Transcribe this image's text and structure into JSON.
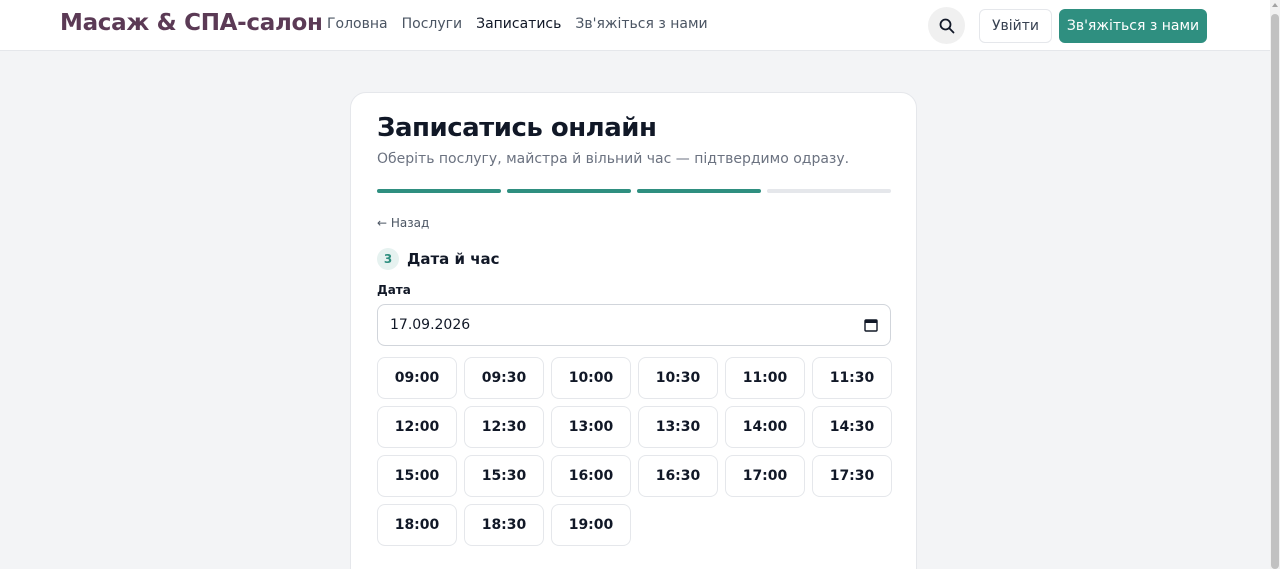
{
  "header": {
    "logo": "Масаж & СПА-салон",
    "nav": [
      {
        "label": "Головна",
        "active": false
      },
      {
        "label": "Послуги",
        "active": false
      },
      {
        "label": "Записатись",
        "active": true
      },
      {
        "label": "Зв'яжіться з нами",
        "active": false
      }
    ],
    "search_icon": "search-icon",
    "login_label": "Увійти",
    "contact_label": "Зв'яжіться з нами"
  },
  "booking": {
    "title": "Записатись онлайн",
    "subtitle": "Оберіть послугу, майстра й вільний час — підтвердимо одразу.",
    "progress": {
      "total_steps": 4,
      "completed_steps": 3
    },
    "back_label": "← Назад",
    "step_number": "3",
    "step_title": "Дата й час",
    "date_label": "Дата",
    "date_value": "17.09.2026",
    "time_slots": [
      "09:00",
      "09:30",
      "10:00",
      "10:30",
      "11:00",
      "11:30",
      "12:00",
      "12:30",
      "13:00",
      "13:30",
      "14:00",
      "14:30",
      "15:00",
      "15:30",
      "16:00",
      "16:30",
      "17:00",
      "17:30",
      "18:00",
      "18:30",
      "19:00"
    ]
  },
  "colors": {
    "brand_logo": "#5b3a55",
    "accent": "#2f8f80",
    "background": "#f3f4f6"
  }
}
